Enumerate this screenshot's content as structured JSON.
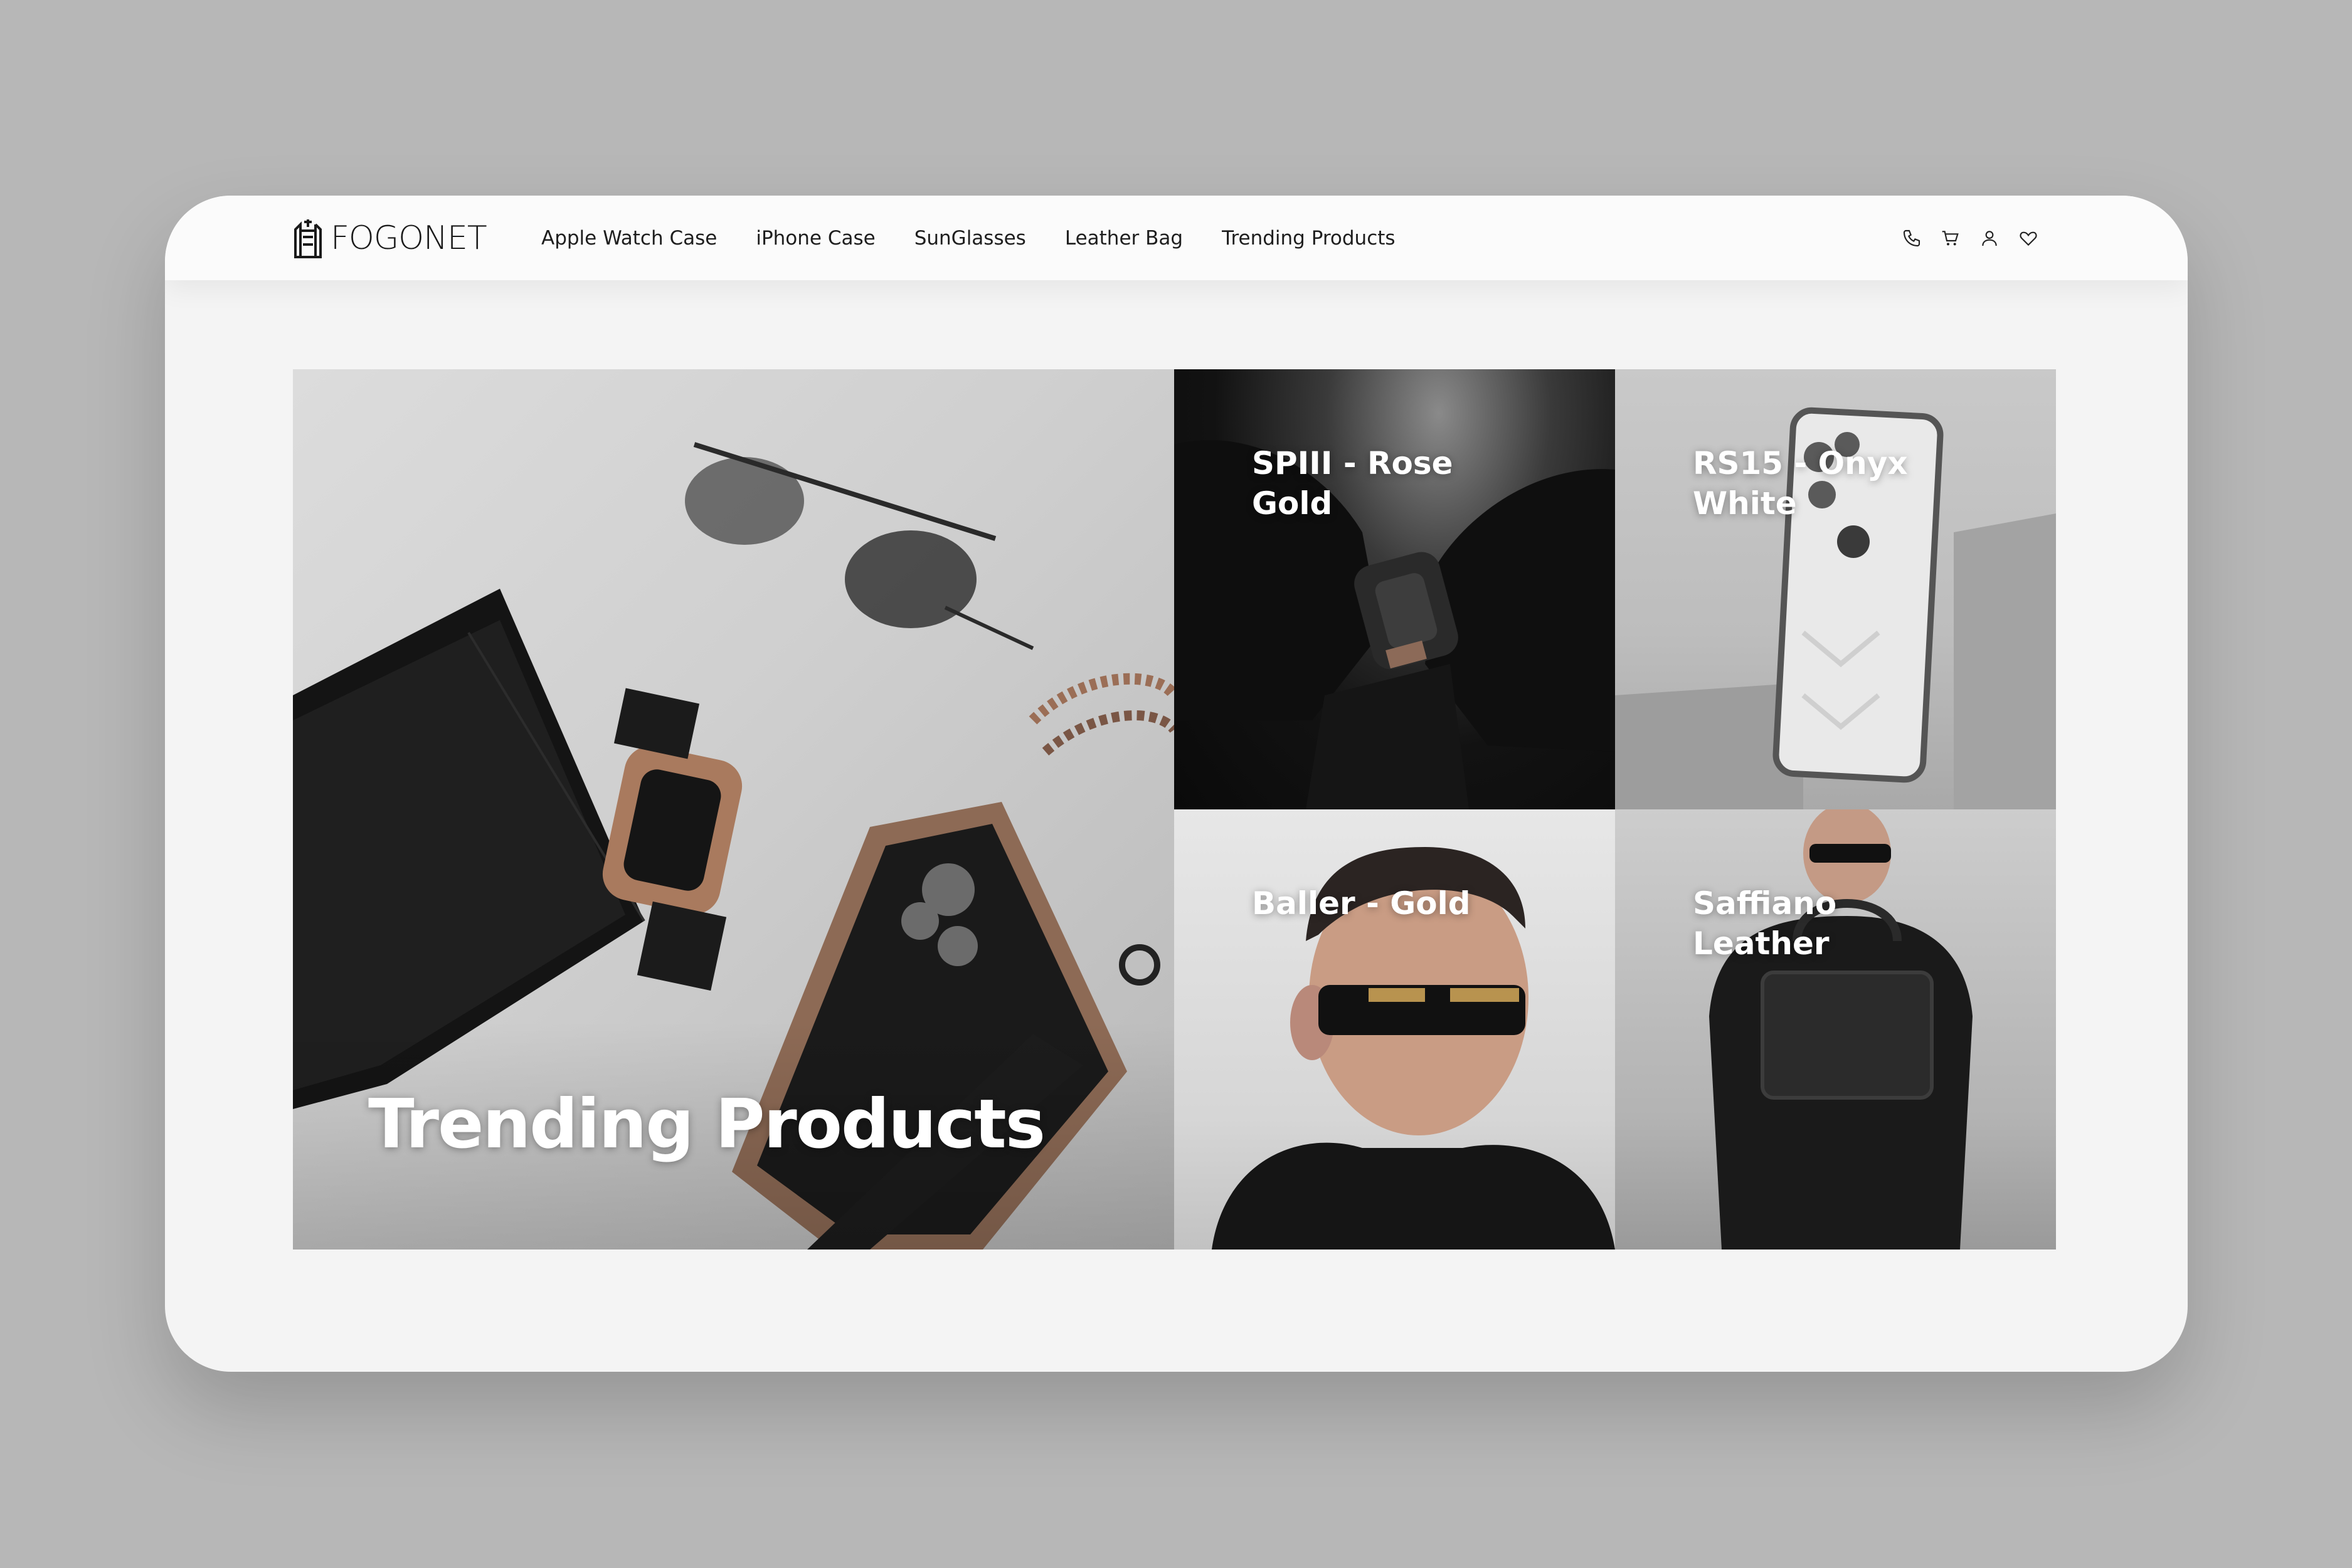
{
  "brand": {
    "name": "FOGONET"
  },
  "nav": {
    "items": [
      {
        "label": "Apple Watch Case"
      },
      {
        "label": "iPhone Case"
      },
      {
        "label": "SunGlasses"
      },
      {
        "label": "Leather Bag"
      },
      {
        "label": "Trending Products"
      }
    ]
  },
  "actions": {
    "icons": [
      "phone-icon",
      "cart-icon",
      "user-icon",
      "heart-icon"
    ]
  },
  "hero": {
    "main": {
      "title": "Trending Products"
    },
    "tiles": [
      {
        "title": "SPIII - Rose Gold"
      },
      {
        "title": "RS15 - Onyx White"
      },
      {
        "title": "Baller - Gold"
      },
      {
        "title": "Saffiano Leather"
      }
    ]
  },
  "colors": {
    "background": "#b7b7b7",
    "window": "#f4f4f4",
    "text_dark": "#1e1e1e",
    "label_white": "#ffffff"
  }
}
